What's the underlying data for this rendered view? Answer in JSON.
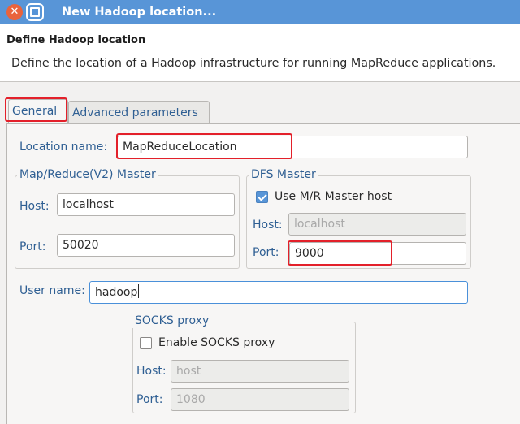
{
  "window": {
    "title": "New Hadoop location..."
  },
  "header": {
    "title": "Define Hadoop location",
    "description": "Define the location of a Hadoop infrastructure for running MapReduce applications."
  },
  "tabs": [
    {
      "label": "General",
      "active": true
    },
    {
      "label": "Advanced parameters",
      "active": false
    }
  ],
  "general": {
    "location_name_label": "Location name:",
    "location_name_value": "MapReduceLocation",
    "mr_master": {
      "title": "Map/Reduce(V2) Master",
      "host_label": "Host:",
      "host_value": "localhost",
      "port_label": "Port:",
      "port_value": "50020"
    },
    "dfs_master": {
      "title": "DFS Master",
      "use_mr_host_label": "Use M/R Master host",
      "use_mr_host_checked": true,
      "host_label": "Host:",
      "host_value": "localhost",
      "port_label": "Port:",
      "port_value": "9000"
    },
    "user_name_label": "User name:",
    "user_name_value": "hadoop",
    "socks_proxy": {
      "title": "SOCKS proxy",
      "enable_label": "Enable SOCKS proxy",
      "enable_checked": false,
      "host_label": "Host:",
      "host_placeholder": "host",
      "port_label": "Port:",
      "port_placeholder": "1080"
    }
  },
  "colors": {
    "titlebar": "#5895d7",
    "highlight": "#e3202a",
    "label": "#2f5f93"
  }
}
